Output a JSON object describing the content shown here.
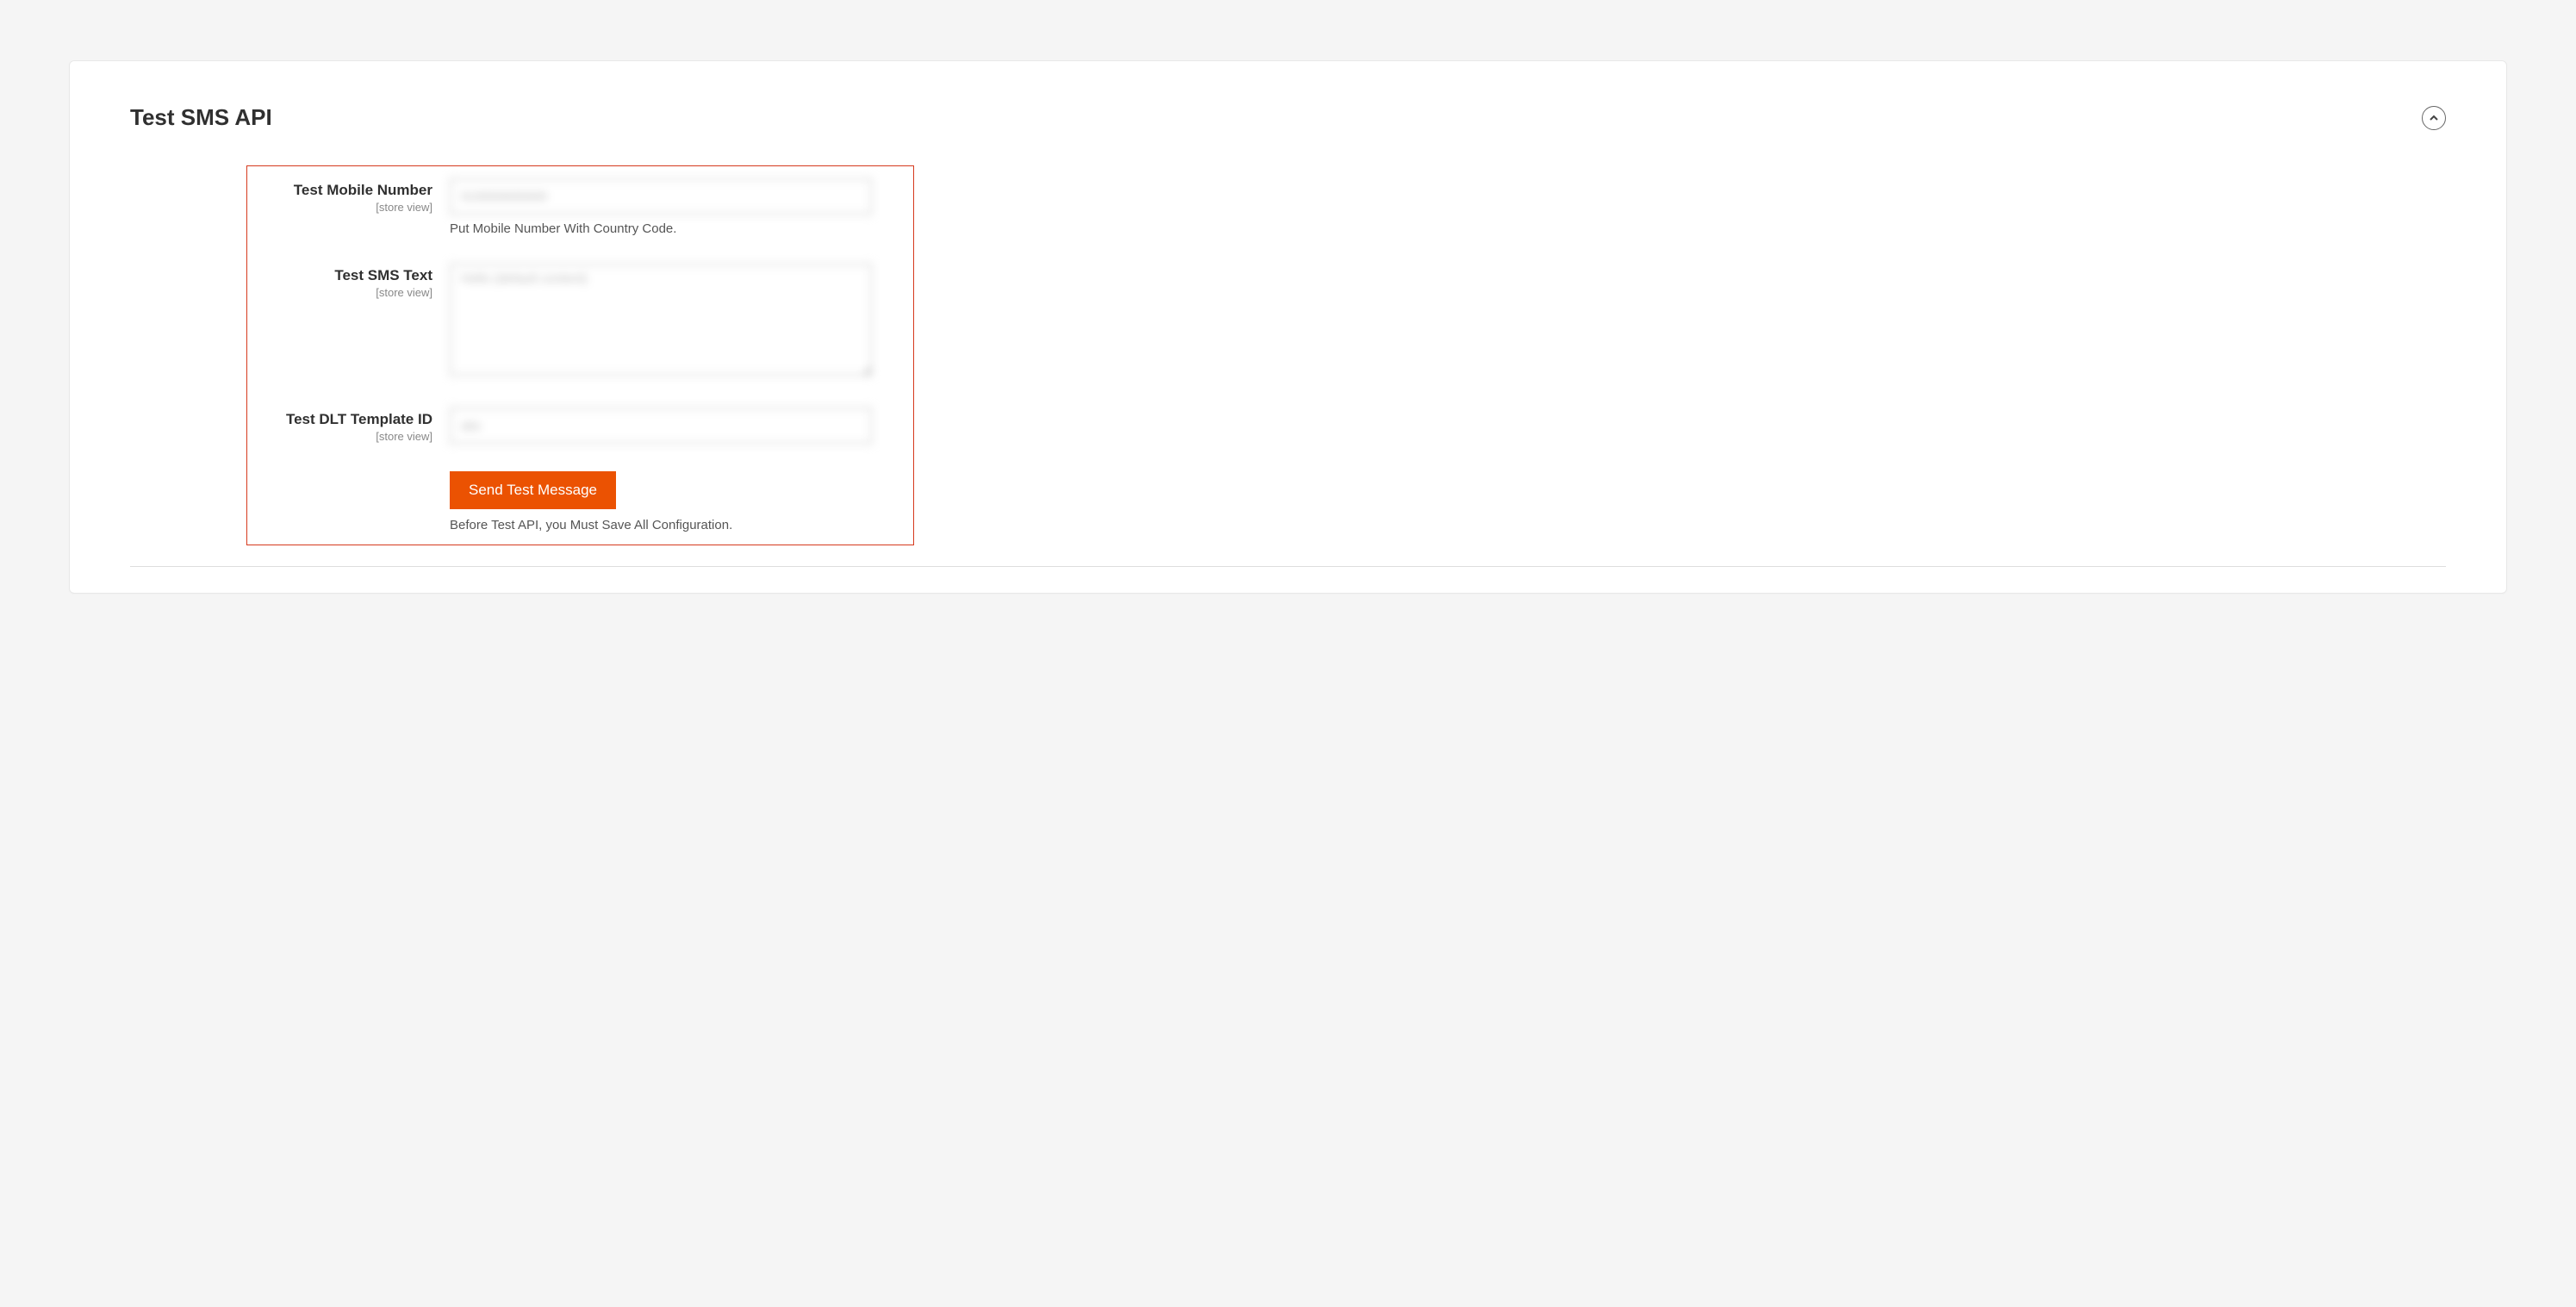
{
  "section": {
    "title": "Test SMS API"
  },
  "fields": {
    "mobile": {
      "label": "Test Mobile Number",
      "scope": "[store view]",
      "value": "919999999999",
      "help": "Put Mobile Number With Country Code."
    },
    "sms_text": {
      "label": "Test SMS Text",
      "scope": "[store view]",
      "value": "Hello (default content)"
    },
    "dlt_template": {
      "label": "Test DLT Template ID",
      "scope": "[store view]",
      "value": "abc"
    }
  },
  "action": {
    "button_label": "Send Test Message",
    "help": "Before Test API, you Must Save All Configuration."
  }
}
